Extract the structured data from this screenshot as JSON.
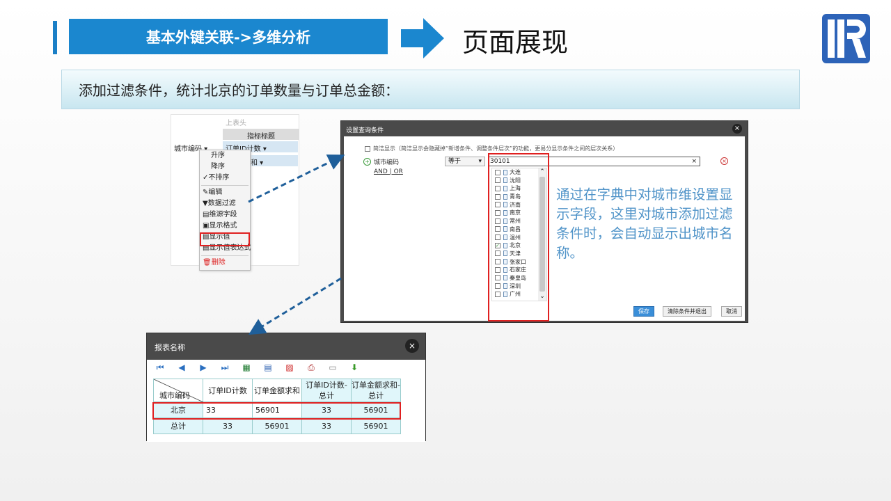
{
  "header": {
    "section_title": "基本外键关联->多维分析",
    "page_heading": "页面展现",
    "subtitle": "添加过滤条件，统计北京的订单数量与订单总金额："
  },
  "context_panel": {
    "top_header": "上表头",
    "indicator_header": "指标标题",
    "city_code": "城市编码 ▾",
    "order_id_count": "订单ID计数 ▾",
    "sum_label": "求和 ▾",
    "menu_items": [
      "升序",
      "降序",
      "不排序",
      "编辑",
      "数据过滤",
      "维源字段",
      "显示格式",
      "显示值",
      "显示值表达式",
      "删除"
    ]
  },
  "dialog": {
    "title": "设置查询条件",
    "note": "简洁显示（简洁显示会隐藏掉“新增条件、调整条件层次”的功能，更易分显示条件之间的层次关系）",
    "field_label": "城市编码",
    "and_or": "AND | OR",
    "operator": "等于",
    "value": "30101",
    "cities": [
      "大连",
      "沈阳",
      "上海",
      "青岛",
      "济南",
      "南京",
      "常州",
      "南昌",
      "温州",
      "北京",
      "天津",
      "张家口",
      "石家庄",
      "秦皇岛",
      "深圳",
      "广州"
    ],
    "checked_city": "北京",
    "explain": "通过在字典中对城市维设置显示字段，这里对城市添加过滤条件时，会自动显示出城市名称。",
    "btn_save": "保存",
    "btn_clear": "清除条件并退出",
    "btn_cancel": "取消"
  },
  "report": {
    "title": "报表名称",
    "corner_label": "城市编码",
    "columns": [
      "订单ID计数",
      "订单金额求和",
      "订单ID计数-总计",
      "订单金额求和-总计"
    ],
    "rows": [
      {
        "label": "北京",
        "values": [
          "33",
          "56901",
          "33",
          "56901"
        ]
      },
      {
        "label": "总计",
        "values": [
          "33",
          "56901",
          "33",
          "56901"
        ]
      }
    ]
  },
  "colors": {
    "accent": "#1b87cf",
    "highlight": "#e02020",
    "explain_text": "#4f93c8"
  }
}
